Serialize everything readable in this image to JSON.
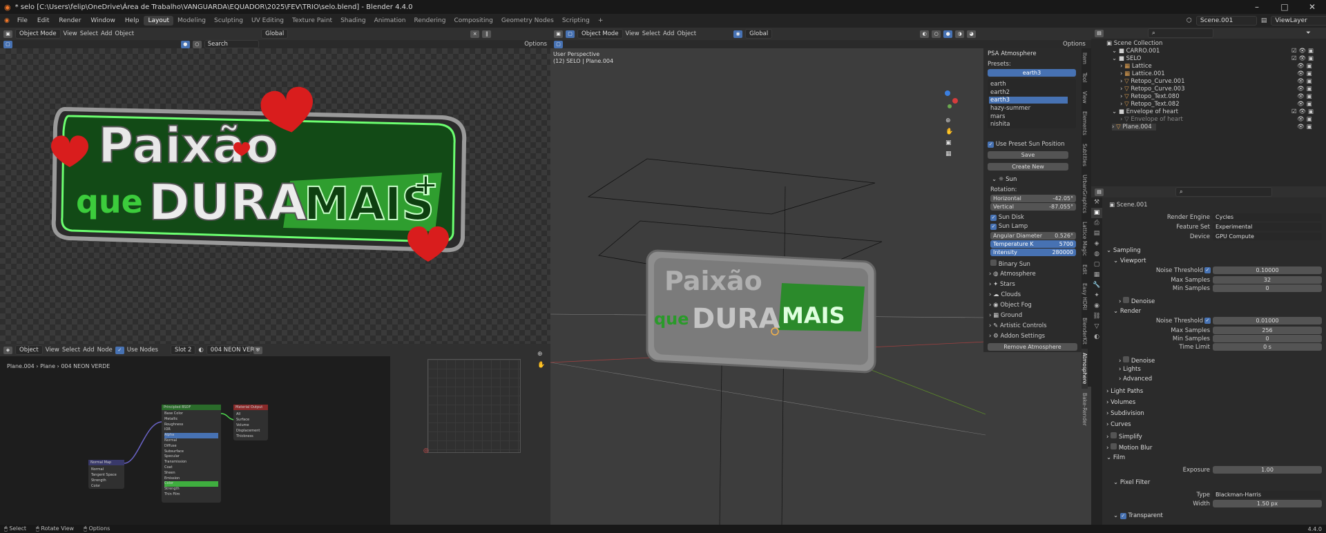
{
  "title": "* selo [C:\\Users\\felip\\OneDrive\\Área de Trabalho\\VANGUARDA\\EQUADOR\\2025\\FEV\\TRIO\\selo.blend] - Blender 4.4.0",
  "menu": [
    "File",
    "Edit",
    "Render",
    "Window",
    "Help"
  ],
  "workspaces": [
    "Layout",
    "Modeling",
    "Sculpting",
    "UV Editing",
    "Texture Paint",
    "Shading",
    "Animation",
    "Rendering",
    "Compositing",
    "Geometry Nodes",
    "Scripting"
  ],
  "workspace_add": "+",
  "scene": "Scene.001",
  "view_layer": "ViewLayer",
  "image_editor": {
    "mode": "Object Mode",
    "menus": [
      "View",
      "Select",
      "Add",
      "Object"
    ],
    "transform": "Global",
    "search_placeholder": "Search",
    "options": "Options",
    "artwork": {
      "line1": "Paixão",
      "line2a": "que",
      "line2b": "DURA",
      "line2c": "MAIS",
      "plus": "+"
    }
  },
  "viewport": {
    "mode": "Object Mode",
    "menus": [
      "View",
      "Select",
      "Add",
      "Object"
    ],
    "transform": "Global",
    "options": "Options",
    "overlay_line1": "User Perspective",
    "overlay_line2": "(12) SELO | Plane.004",
    "npanel": {
      "title": "PSA Atmosphere",
      "presets_label": "Presets:",
      "preset_selected": "earth3",
      "preset_list": [
        "earth",
        "earth2",
        "earth3",
        "hazy-summer",
        "mars",
        "nishita"
      ],
      "use_preset_sun": "Use Preset Sun Position",
      "save_label": "Save",
      "create_new_label": "Create New",
      "sun_section": "Sun",
      "rotation_label": "Rotation:",
      "horizontal_label": "Horizontal",
      "horizontal_value": "-42.05°",
      "vertical_label": "Vertical",
      "vertical_value": "-87.055°",
      "sun_disk": "Sun Disk",
      "sun_lamp": "Sun Lamp",
      "angular_label": "Angular Diameter",
      "angular_value": "0.526°",
      "temperature_label": "Temperature K",
      "temperature_value": "5700",
      "intensity_label": "Intensity",
      "intensity_value": "280000",
      "binary_sun": "Binary Sun",
      "sections": [
        "Atmosphere",
        "Stars",
        "Clouds",
        "Object Fog",
        "Ground",
        "Artistic Controls",
        "Addon Settings"
      ],
      "remove": "Remove Atmosphere"
    },
    "tabs": [
      "Item",
      "Tool",
      "View",
      "Elements",
      "Subtitles",
      "UrbanGraphics",
      "Lattice Magic",
      "Edit",
      "Easy HDRI",
      "BlenderKit",
      "Atmosphere",
      "Bake-Render"
    ]
  },
  "node_editor": {
    "type": "Object",
    "menus": [
      "View",
      "Select",
      "Add",
      "Node"
    ],
    "use_nodes": "Use Nodes",
    "slot": "Slot 2",
    "material": "004 NEON VERDE",
    "breadcrumb": [
      "Plane.004",
      "Plane",
      "004 NEON VERDE"
    ],
    "bsdf_title": "Principled BSDF",
    "bsdf_rows": [
      "Base Color",
      "Metallic",
      "Roughness",
      "IOR",
      "Alpha",
      "Normal",
      "Diffuse",
      "Subsurface",
      "Specular",
      "Transmission",
      "Coat",
      "Sheen",
      "Emission",
      "Color",
      "Strength",
      "Thin Film"
    ],
    "output_title": "Material Output",
    "output_rows": [
      "All",
      "Surface",
      "Volume",
      "Displacement",
      "Thickness"
    ],
    "normal_title": "Normal Map",
    "normal_rows": [
      "Normal",
      "Tangent Space",
      "Strength",
      "Color"
    ]
  },
  "outliner": {
    "search_placeholder": "",
    "items": [
      {
        "name": "Scene Collection",
        "indent": 0
      },
      {
        "name": "CARRO.001",
        "indent": 1
      },
      {
        "name": "SELO",
        "indent": 1
      },
      {
        "name": "Lattice",
        "indent": 2
      },
      {
        "name": "Lattice.001",
        "indent": 2
      },
      {
        "name": "Retopo_Curve.001",
        "indent": 2
      },
      {
        "name": "Retopo_Curve.003",
        "indent": 2
      },
      {
        "name": "Retopo_Text.080",
        "indent": 2
      },
      {
        "name": "Retopo_Text.082",
        "indent": 2
      },
      {
        "name": "Envelope of heart",
        "indent": 1
      },
      {
        "name": "Envelope of heart",
        "indent": 2
      },
      {
        "name": "Plane.004",
        "indent": 1
      }
    ]
  },
  "properties": {
    "scene": "Scene.001",
    "render_engine_label": "Render Engine",
    "render_engine": "Cycles",
    "feature_set_label": "Feature Set",
    "feature_set": "Experimental",
    "device_label": "Device",
    "device": "GPU Compute",
    "sampling": "Sampling",
    "viewport": "Viewport",
    "noise_threshold_label": "Noise Threshold",
    "vp_noise": "0.10000",
    "max_samples_label": "Max Samples",
    "vp_max": "32",
    "min_samples_label": "Min Samples",
    "vp_min": "0",
    "denoise": "Denoise",
    "render": "Render",
    "r_noise": "0.01000",
    "r_max": "256",
    "r_min": "0",
    "time_limit_label": "Time Limit",
    "r_time": "0 s",
    "subsections": [
      "Denoise",
      "Lights",
      "Advanced"
    ],
    "sections": [
      "Light Paths",
      "Volumes",
      "Subdivision",
      "Curves",
      "Simplify",
      "Motion Blur",
      "Film"
    ],
    "exposure_label": "Exposure",
    "exposure": "1.00",
    "pixel_filter": "Pixel Filter",
    "type_label": "Type",
    "type": "Blackman-Harris",
    "width_label": "Width",
    "width": "1.50 px",
    "transparent": "Transparent"
  },
  "status": [
    "Select",
    "Rotate View",
    "Options"
  ],
  "version": "4.4.0"
}
